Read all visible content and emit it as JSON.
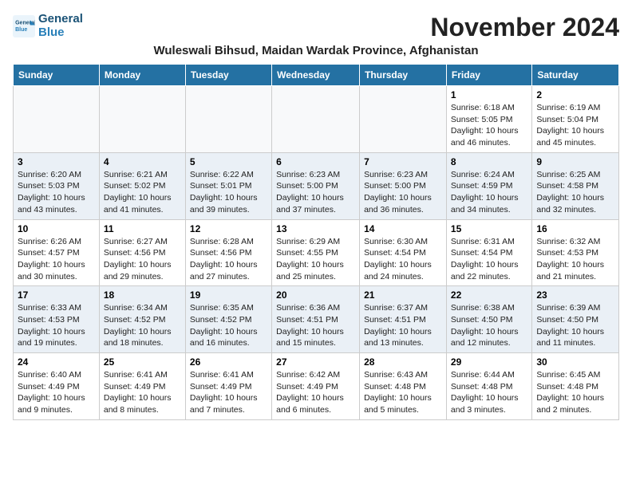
{
  "logo": {
    "line1": "General",
    "line2": "Blue"
  },
  "header": {
    "month": "November 2024",
    "location": "Wuleswali Bihsud, Maidan Wardak Province, Afghanistan"
  },
  "weekdays": [
    "Sunday",
    "Monday",
    "Tuesday",
    "Wednesday",
    "Thursday",
    "Friday",
    "Saturday"
  ],
  "weeks": [
    [
      {
        "day": "",
        "info": ""
      },
      {
        "day": "",
        "info": ""
      },
      {
        "day": "",
        "info": ""
      },
      {
        "day": "",
        "info": ""
      },
      {
        "day": "",
        "info": ""
      },
      {
        "day": "1",
        "info": "Sunrise: 6:18 AM\nSunset: 5:05 PM\nDaylight: 10 hours and 46 minutes."
      },
      {
        "day": "2",
        "info": "Sunrise: 6:19 AM\nSunset: 5:04 PM\nDaylight: 10 hours and 45 minutes."
      }
    ],
    [
      {
        "day": "3",
        "info": "Sunrise: 6:20 AM\nSunset: 5:03 PM\nDaylight: 10 hours and 43 minutes."
      },
      {
        "day": "4",
        "info": "Sunrise: 6:21 AM\nSunset: 5:02 PM\nDaylight: 10 hours and 41 minutes."
      },
      {
        "day": "5",
        "info": "Sunrise: 6:22 AM\nSunset: 5:01 PM\nDaylight: 10 hours and 39 minutes."
      },
      {
        "day": "6",
        "info": "Sunrise: 6:23 AM\nSunset: 5:00 PM\nDaylight: 10 hours and 37 minutes."
      },
      {
        "day": "7",
        "info": "Sunrise: 6:23 AM\nSunset: 5:00 PM\nDaylight: 10 hours and 36 minutes."
      },
      {
        "day": "8",
        "info": "Sunrise: 6:24 AM\nSunset: 4:59 PM\nDaylight: 10 hours and 34 minutes."
      },
      {
        "day": "9",
        "info": "Sunrise: 6:25 AM\nSunset: 4:58 PM\nDaylight: 10 hours and 32 minutes."
      }
    ],
    [
      {
        "day": "10",
        "info": "Sunrise: 6:26 AM\nSunset: 4:57 PM\nDaylight: 10 hours and 30 minutes."
      },
      {
        "day": "11",
        "info": "Sunrise: 6:27 AM\nSunset: 4:56 PM\nDaylight: 10 hours and 29 minutes."
      },
      {
        "day": "12",
        "info": "Sunrise: 6:28 AM\nSunset: 4:56 PM\nDaylight: 10 hours and 27 minutes."
      },
      {
        "day": "13",
        "info": "Sunrise: 6:29 AM\nSunset: 4:55 PM\nDaylight: 10 hours and 25 minutes."
      },
      {
        "day": "14",
        "info": "Sunrise: 6:30 AM\nSunset: 4:54 PM\nDaylight: 10 hours and 24 minutes."
      },
      {
        "day": "15",
        "info": "Sunrise: 6:31 AM\nSunset: 4:54 PM\nDaylight: 10 hours and 22 minutes."
      },
      {
        "day": "16",
        "info": "Sunrise: 6:32 AM\nSunset: 4:53 PM\nDaylight: 10 hours and 21 minutes."
      }
    ],
    [
      {
        "day": "17",
        "info": "Sunrise: 6:33 AM\nSunset: 4:53 PM\nDaylight: 10 hours and 19 minutes."
      },
      {
        "day": "18",
        "info": "Sunrise: 6:34 AM\nSunset: 4:52 PM\nDaylight: 10 hours and 18 minutes."
      },
      {
        "day": "19",
        "info": "Sunrise: 6:35 AM\nSunset: 4:52 PM\nDaylight: 10 hours and 16 minutes."
      },
      {
        "day": "20",
        "info": "Sunrise: 6:36 AM\nSunset: 4:51 PM\nDaylight: 10 hours and 15 minutes."
      },
      {
        "day": "21",
        "info": "Sunrise: 6:37 AM\nSunset: 4:51 PM\nDaylight: 10 hours and 13 minutes."
      },
      {
        "day": "22",
        "info": "Sunrise: 6:38 AM\nSunset: 4:50 PM\nDaylight: 10 hours and 12 minutes."
      },
      {
        "day": "23",
        "info": "Sunrise: 6:39 AM\nSunset: 4:50 PM\nDaylight: 10 hours and 11 minutes."
      }
    ],
    [
      {
        "day": "24",
        "info": "Sunrise: 6:40 AM\nSunset: 4:49 PM\nDaylight: 10 hours and 9 minutes."
      },
      {
        "day": "25",
        "info": "Sunrise: 6:41 AM\nSunset: 4:49 PM\nDaylight: 10 hours and 8 minutes."
      },
      {
        "day": "26",
        "info": "Sunrise: 6:41 AM\nSunset: 4:49 PM\nDaylight: 10 hours and 7 minutes."
      },
      {
        "day": "27",
        "info": "Sunrise: 6:42 AM\nSunset: 4:49 PM\nDaylight: 10 hours and 6 minutes."
      },
      {
        "day": "28",
        "info": "Sunrise: 6:43 AM\nSunset: 4:48 PM\nDaylight: 10 hours and 5 minutes."
      },
      {
        "day": "29",
        "info": "Sunrise: 6:44 AM\nSunset: 4:48 PM\nDaylight: 10 hours and 3 minutes."
      },
      {
        "day": "30",
        "info": "Sunrise: 6:45 AM\nSunset: 4:48 PM\nDaylight: 10 hours and 2 minutes."
      }
    ]
  ]
}
